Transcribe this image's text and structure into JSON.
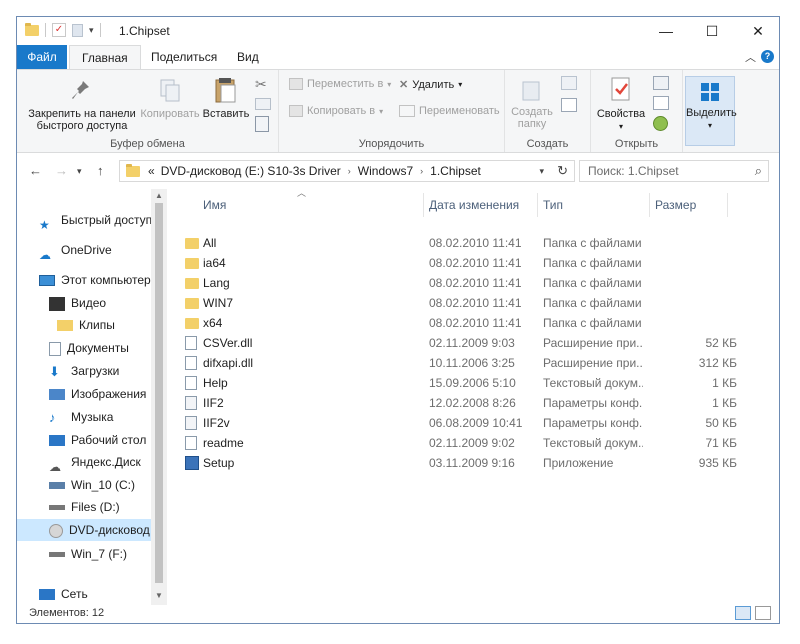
{
  "window": {
    "title": "1.Chipset",
    "minimize": "—",
    "maximize": "☐",
    "close": "✕"
  },
  "tabs": {
    "file": "Файл",
    "home": "Главная",
    "share": "Поделиться",
    "view": "Вид"
  },
  "ribbon": {
    "clipboard": {
      "label": "Буфер обмена",
      "pin_line1": "Закрепить на панели",
      "pin_line2": "быстрого доступа",
      "copy": "Копировать",
      "paste": "Вставить"
    },
    "organize": {
      "label": "Упорядочить",
      "move_to": "Переместить в",
      "copy_to": "Копировать в",
      "delete": "Удалить",
      "rename": "Переименовать"
    },
    "new": {
      "label": "Создать",
      "new_folder_line1": "Создать",
      "new_folder_line2": "папку"
    },
    "open": {
      "label": "Открыть",
      "properties": "Свойства"
    },
    "select": {
      "label": "Выделить"
    }
  },
  "address": {
    "segments": [
      "«",
      "DVD-дисковод (E:) S10-3s Driver",
      "Windows7",
      "1.Chipset"
    ],
    "search_placeholder": "Поиск: 1.Chipset"
  },
  "nav": {
    "items": [
      {
        "label": "Быстрый доступ",
        "icon": "star-icon"
      },
      {
        "label": "OneDrive",
        "icon": "cloud-icon"
      },
      {
        "label": "Этот компьютер",
        "icon": "computer-icon"
      },
      {
        "label": "Видео",
        "icon": "video-icon"
      },
      {
        "label": "Клипы",
        "icon": "folder-icon"
      },
      {
        "label": "Документы",
        "icon": "document-icon"
      },
      {
        "label": "Загрузки",
        "icon": "download-icon"
      },
      {
        "label": "Изображения",
        "icon": "pictures-icon"
      },
      {
        "label": "Музыка",
        "icon": "music-icon"
      },
      {
        "label": "Рабочий стол",
        "icon": "desktop-icon"
      },
      {
        "label": "Яндекс.Диск",
        "icon": "yandex-disk-icon"
      },
      {
        "label": "Win_10 (C:)",
        "icon": "drive-icon"
      },
      {
        "label": "Files (D:)",
        "icon": "drive-icon"
      },
      {
        "label": "DVD-дисковод (",
        "icon": "dvd-icon"
      },
      {
        "label": "Win_7 (F:)",
        "icon": "drive-icon"
      },
      {
        "label": "Сеть",
        "icon": "network-icon"
      }
    ]
  },
  "columns": {
    "name": "Имя",
    "date": "Дата изменения",
    "type": "Тип",
    "size": "Размер"
  },
  "files": [
    {
      "name": "All",
      "date": "08.02.2010 11:41",
      "type": "Папка с файлами",
      "size": "",
      "icon": "folder-icon"
    },
    {
      "name": "ia64",
      "date": "08.02.2010 11:41",
      "type": "Папка с файлами",
      "size": "",
      "icon": "folder-icon"
    },
    {
      "name": "Lang",
      "date": "08.02.2010 11:41",
      "type": "Папка с файлами",
      "size": "",
      "icon": "folder-icon"
    },
    {
      "name": "WIN7",
      "date": "08.02.2010 11:41",
      "type": "Папка с файлами",
      "size": "",
      "icon": "folder-icon"
    },
    {
      "name": "x64",
      "date": "08.02.2010 11:41",
      "type": "Папка с файлами",
      "size": "",
      "icon": "folder-icon"
    },
    {
      "name": "CSVer.dll",
      "date": "02.11.2009 9:03",
      "type": "Расширение при...",
      "size": "52 КБ",
      "icon": "dll-icon"
    },
    {
      "name": "difxapi.dll",
      "date": "10.11.2006 3:25",
      "type": "Расширение при...",
      "size": "312 КБ",
      "icon": "dll-icon"
    },
    {
      "name": "Help",
      "date": "15.09.2006 5:10",
      "type": "Текстовый докум...",
      "size": "1 КБ",
      "icon": "text-file-icon"
    },
    {
      "name": "IIF2",
      "date": "12.02.2008 8:26",
      "type": "Параметры конф...",
      "size": "1 КБ",
      "icon": "config-file-icon"
    },
    {
      "name": "IIF2v",
      "date": "06.08.2009 10:41",
      "type": "Параметры конф...",
      "size": "50 КБ",
      "icon": "config-file-icon"
    },
    {
      "name": "readme",
      "date": "02.11.2009 9:02",
      "type": "Текстовый докум...",
      "size": "71 КБ",
      "icon": "text-file-icon"
    },
    {
      "name": "Setup",
      "date": "03.11.2009 9:16",
      "type": "Приложение",
      "size": "935 КБ",
      "icon": "setup-app-icon"
    }
  ],
  "status": {
    "items_count": "Элементов: 12"
  },
  "colors": {
    "accent": "#1979ca",
    "selection": "#cce8ff",
    "folder": "#f3d069"
  }
}
